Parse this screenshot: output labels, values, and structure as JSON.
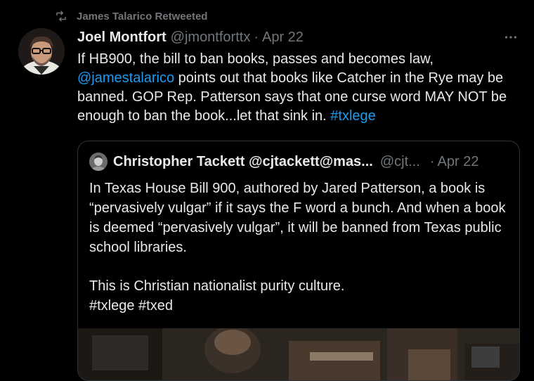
{
  "retweet": {
    "label": "James Talarico Retweeted",
    "icon": "retweet-icon"
  },
  "tweet": {
    "author_name": "Joel Montfort",
    "author_handle": "@jmontforttx",
    "separator": "·",
    "date": "Apr 22",
    "more_icon": "more-horizontal-icon",
    "text_part1": "If HB900, the bill to ban books, passes and becomes law, ",
    "mention": "@jamestalarico",
    "text_part2": " points out that books like Catcher in the Rye may be banned.  GOP Rep. Patterson says that one curse word MAY NOT be enough to ban the book...let that sink in. ",
    "hashtag": "#txlege"
  },
  "quote": {
    "author_name": "Christopher Tackett @cjtackett@mas...",
    "author_handle": "@cjt...",
    "separator": "·",
    "date": "Apr 22",
    "paragraph1": "In Texas House Bill 900, authored by Jared Patterson, a book is “pervasively vulgar” if it says the F word a bunch. And when a book is deemed “pervasively vulgar”, it will be banned from Texas public school libraries.",
    "paragraph2": "This is Christian nationalist purity culture.",
    "paragraph3": "#txlege #txed"
  },
  "colors": {
    "background": "#000000",
    "text": "#e7e9ea",
    "secondary": "#71767b",
    "link": "#1d9bf0",
    "border": "#2f3336"
  }
}
